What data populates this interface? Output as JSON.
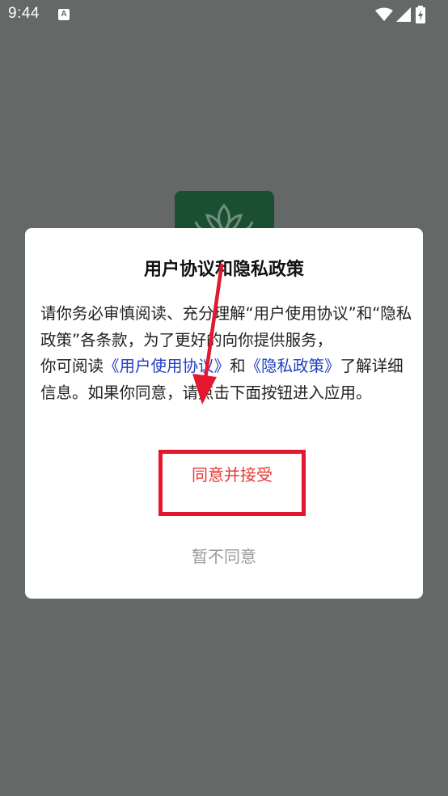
{
  "status_bar": {
    "time": "9:44",
    "notification_icon_letter": "A",
    "icons": [
      "a-notification-icon",
      "wifi-icon",
      "signal-icon",
      "battery-icon"
    ]
  },
  "dialog": {
    "title": "用户协议和隐私政策",
    "body_part1": "请你务必审慎阅读、充分理解“用户使用协议”和“隐私政策”各条款，为了更好的向你提供服务，",
    "body_part2_prefix": "你可阅读",
    "link_user_agreement": "《用户使用协议》",
    "and_text": "和",
    "link_privacy_policy": "《隐私政策》",
    "body_part2_suffix": "了解详细信息。如果你同意，请点击下面按钮进入应用。",
    "accept_label": "同意并接受",
    "decline_label": "暂不同意"
  },
  "colors": {
    "overlay": "#646866",
    "link": "#1f3cc4",
    "accept": "#e53935",
    "decline": "#9a9a9a",
    "annotation": "#e3172e",
    "logo_bg": "#1b4f34"
  }
}
